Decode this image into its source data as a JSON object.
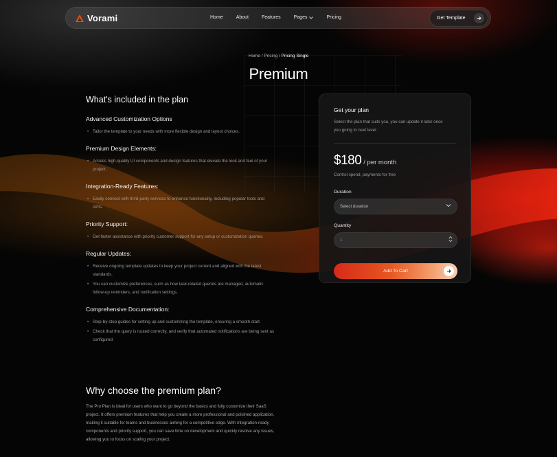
{
  "brand": {
    "name": "Vorami",
    "accent": "#e4521d"
  },
  "nav": {
    "links": [
      {
        "label": "Home"
      },
      {
        "label": "About"
      },
      {
        "label": "Features"
      },
      {
        "label": "Pages"
      },
      {
        "label": "Pricing"
      }
    ],
    "cta_label": "Get Template"
  },
  "breadcrumb": {
    "home": "Home",
    "sep": "/",
    "pricing": "Pricing",
    "current": "Pricing Single"
  },
  "page_title": "Premium",
  "included": {
    "heading": "What's included in the plan",
    "features": [
      {
        "title": "Advanced Customization Options",
        "bullets": [
          "Tailor the template to your needs with more flexible design and layout choices."
        ]
      },
      {
        "title": "Premium Design Elements:",
        "bullets": [
          "Access high-quality UI components and design features that elevate the look and feel of your project."
        ]
      },
      {
        "title": "Integration-Ready Features:",
        "bullets": [
          "Easily connect with third-party services to enhance functionality, including popular tools and APIs."
        ]
      },
      {
        "title": "Priority Support:",
        "bullets": [
          "Get faster assistance with priority customer support for any setup or customization queries."
        ]
      },
      {
        "title": "Regular Updates:",
        "bullets": [
          "Receive ongoing template updates to keep your project current and aligned with the latest standards.",
          "You can customize preferences, such as how task-related queries are managed, automatic follow-up reminders, and notification settings."
        ]
      },
      {
        "title": "Comprehensive Documentation:",
        "bullets": [
          "Step-by-step guides for setting up and customizing the template, ensuring a smooth start.",
          "Check that the query is routed correctly, and verify that automated notifications are being sent as configured."
        ]
      }
    ]
  },
  "why": {
    "heading": "Why choose the premium plan?",
    "body": "The Pro Plan is ideal for users who want to go beyond the basics and fully customize their SaaS project. It offers premium features that help you create a more professional and polished application, making it suitable for teams and businesses aiming for a competitive edge. With integration-ready components and priority support, you can save time on development and quickly resolve any issues, allowing you to focus on scaling your project."
  },
  "plan_card": {
    "title": "Get your plan",
    "description": "Select the plan that suits you, you can update it later once you going to next level",
    "price": "$180",
    "per": "/ per month",
    "price_note": "Control spend, payments for free",
    "duration_label": "Duration",
    "duration_value": "Select duration",
    "quantity_label": "Quantity",
    "quantity_value": "1",
    "add_to_cart_label": "Add To Cart"
  }
}
